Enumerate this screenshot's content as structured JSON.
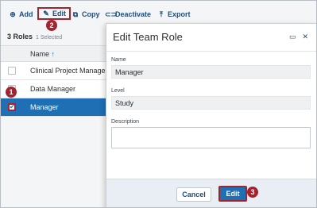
{
  "toolbar": {
    "add_label": "Add",
    "edit_label": "Edit",
    "copy_label": "Copy",
    "deactivate_label": "Deactivate",
    "export_label": "Export"
  },
  "list": {
    "count": "3 Roles",
    "selected_text": "1 Selected",
    "column_header": "Name",
    "sort_arrow": "↑",
    "rows": [
      {
        "name": "Clinical Project Manager",
        "checked": false
      },
      {
        "name": "Data Manager",
        "checked": false
      },
      {
        "name": "Manager",
        "checked": true
      }
    ]
  },
  "modal": {
    "title": "Edit Team Role",
    "name_label": "Name",
    "name_value": "Manager",
    "level_label": "Level",
    "level_value": "Study",
    "description_label": "Description",
    "description_value": "",
    "cancel_label": "Cancel",
    "edit_label": "Edit"
  },
  "callouts": {
    "one": "1",
    "two": "2",
    "three": "3"
  },
  "colors": {
    "accent": "#1f6fb5",
    "callout": "#a3242f",
    "toolbar_text": "#1f4d7a"
  }
}
